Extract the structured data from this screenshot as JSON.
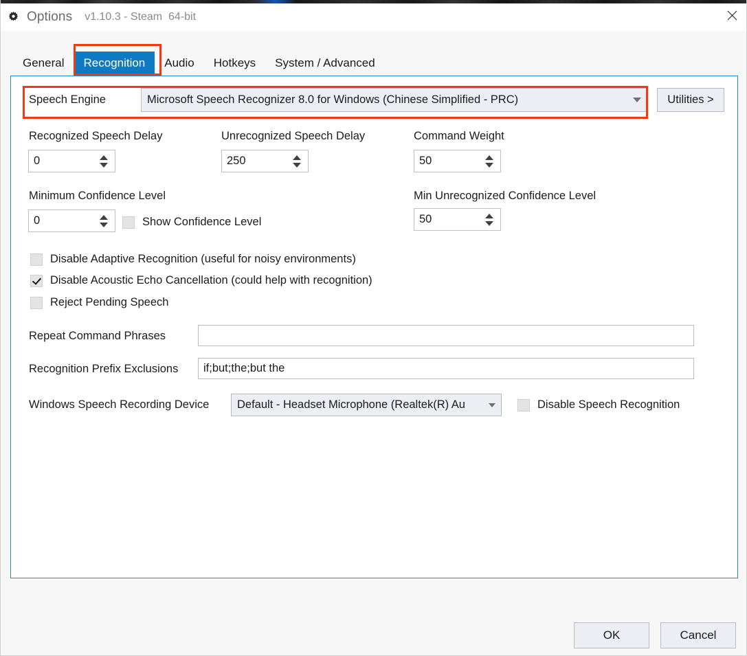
{
  "window": {
    "title": "Options",
    "version": "v1.10.3 - Steam  64-bit",
    "gear_icon": "gear-icon",
    "close_icon": "close-icon",
    "accent_color": "#0f7ac4",
    "panel_border_color": "#1f8ad0",
    "annotation_color": "#f33a0e"
  },
  "tabs": [
    {
      "label": "General",
      "active": false
    },
    {
      "label": "Recognition",
      "active": true
    },
    {
      "label": "Audio",
      "active": false
    },
    {
      "label": "Hotkeys",
      "active": false
    },
    {
      "label": "System / Advanced",
      "active": false
    }
  ],
  "engine": {
    "label": "Speech Engine",
    "value": "Microsoft Speech Recognizer 8.0 for Windows (Chinese Simplified - PRC)",
    "dropdown_icon": "chevron-down-icon",
    "utilities_button": "Utilities >"
  },
  "spinners": [
    {
      "label": "Recognized Speech Delay",
      "value": "0"
    },
    {
      "label": "Unrecognized Speech Delay",
      "value": "250"
    },
    {
      "label": "Command Weight",
      "value": "50"
    },
    {
      "label": "Minimum Confidence Level",
      "value": "0"
    },
    {
      "label": "Min Unrecognized Confidence Level",
      "value": "50"
    }
  ],
  "show_confidence": {
    "label": "Show Confidence Level",
    "checked": false
  },
  "checkboxes": [
    {
      "label": "Disable Adaptive Recognition (useful for noisy environments)",
      "checked": false
    },
    {
      "label": "Disable Acoustic Echo Cancellation (could help with recognition)",
      "checked": true
    },
    {
      "label": "Reject Pending Speech",
      "checked": false
    }
  ],
  "text_fields": [
    {
      "label": "Repeat Command Phrases",
      "value": "",
      "placeholder": ""
    },
    {
      "label": "Recognition Prefix Exclusions",
      "value": "if;but;the;but the",
      "placeholder": ""
    }
  ],
  "recording_device": {
    "label": "Windows Speech Recording Device",
    "value": "Default - Headset Microphone (Realtek(R) Au",
    "dropdown_icon": "chevron-down-icon"
  },
  "disable_recognition": {
    "label": "Disable Speech Recognition",
    "checked": false
  },
  "footer": {
    "ok_label": "OK",
    "cancel_label": "Cancel"
  }
}
